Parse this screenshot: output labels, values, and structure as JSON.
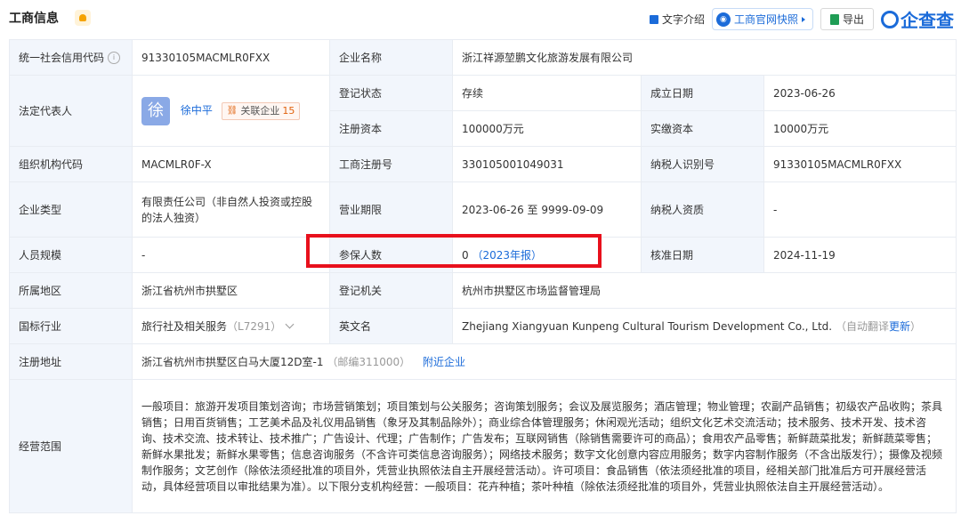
{
  "header": {
    "title": "工商信息",
    "text_intro": "文字介绍",
    "snapshot": "工商官网快照",
    "export": "导出",
    "logo": "企查查",
    "icons": [
      "bell-icon",
      "doc-icon",
      "camera-icon",
      "excel-icon",
      "qcc-logo-icon"
    ]
  },
  "rows": {
    "credit_code_label": "统一社会信用代码",
    "credit_code": "91330105MACMLR0FXX",
    "company_name_label": "企业名称",
    "company_name": "浙江祥源堃鹏文化旅游发展有限公司",
    "legal_rep_label": "法定代表人",
    "legal_rep_avatar": "徐",
    "legal_rep_name": "徐中平",
    "related_label": "关联企业",
    "related_count": "15",
    "reg_status_label": "登记状态",
    "reg_status": "存续",
    "found_date_label": "成立日期",
    "found_date": "2023-06-26",
    "reg_capital_label": "注册资本",
    "reg_capital": "100000万元",
    "paid_capital_label": "实缴资本",
    "paid_capital": "10000万元",
    "org_code_label": "组织机构代码",
    "org_code": "MACMLR0F-X",
    "biz_reg_no_label": "工商注册号",
    "biz_reg_no": "330105001049031",
    "taxpayer_id_label": "纳税人识别号",
    "taxpayer_id": "91330105MACMLR0FXX",
    "company_type_label": "企业类型",
    "company_type": "有限责任公司（非自然人投资或控股的法人独资）",
    "biz_term_label": "营业期限",
    "biz_term": "2023-06-26 至 9999-09-09",
    "taxpayer_qual_label": "纳税人资质",
    "taxpayer_qual": "-",
    "staff_size_label": "人员规模",
    "staff_size": "-",
    "insured_label": "参保人数",
    "insured_count": "0",
    "insured_report": "（2023年报）",
    "approve_date_label": "核准日期",
    "approve_date": "2024-11-19",
    "region_label": "所属地区",
    "region": "浙江省杭州市拱墅区",
    "reg_authority_label": "登记机关",
    "reg_authority": "杭州市拱墅区市场监督管理局",
    "industry_label": "国标行业",
    "industry": "旅行社及相关服务",
    "industry_code": "（L7291）",
    "english_name_label": "英文名",
    "english_name": "Zhejiang Xiangyuan Kunpeng Cultural Tourism Development Co., Ltd.",
    "auto_translate": "（自动翻译",
    "update_link": "更新",
    "close_paren": "）",
    "address_label": "注册地址",
    "address": "浙江省杭州市拱墅区白马大厦12D室-1",
    "postcode": "（邮编311000）",
    "nearby_link": "附近企业",
    "scope_label": "经营范围",
    "scope": "一般项目：旅游开发项目策划咨询；市场营销策划；项目策划与公关服务；咨询策划服务；会议及展览服务；酒店管理；物业管理；农副产品销售；初级农产品收购；茶具销售；日用百货销售；工艺美术品及礼仪用品销售（象牙及其制品除外）；商业综合体管理服务；休闲观光活动；组织文化艺术交流活动；技术服务、技术开发、技术咨询、技术交流、技术转让、技术推广；广告设计、代理；广告制作；广告发布；互联网销售（除销售需要许可的商品）；食用农产品零售；新鲜蔬菜批发；新鲜蔬菜零售；新鲜水果批发；新鲜水果零售；信息咨询服务（不含许可类信息咨询服务）；网络技术服务；数字文化创意内容应用服务；数字内容制作服务（不含出版发行）；摄像及视频制作服务；文艺创作（除依法须经批准的项目外，凭营业执照依法自主开展经营活动）。许可项目：食品销售（依法须经批准的项目，经相关部门批准后方可开展经营活动，具体经营项目以审批结果为准）。以下限分支机构经营：一般项目：花卉种植；茶叶种植（除依法须经批准的项目外，凭营业执照依法自主开展经营活动）。"
  }
}
